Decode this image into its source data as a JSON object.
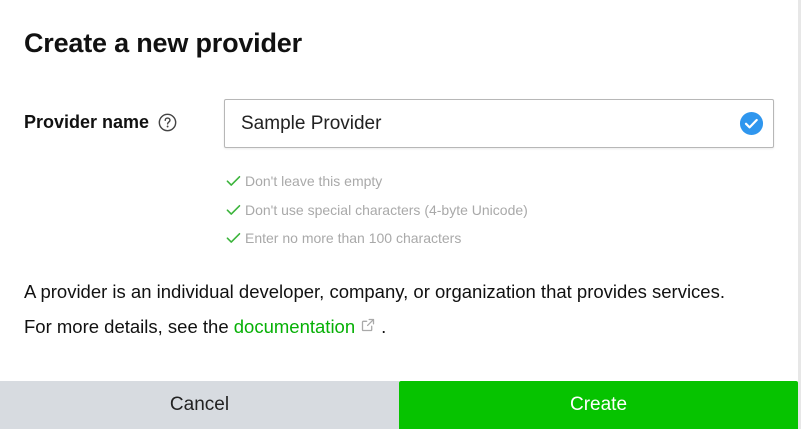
{
  "dialog": {
    "title": "Create a new provider"
  },
  "field": {
    "label": "Provider name",
    "help_icon": "question-circle-icon",
    "value": "Sample Provider",
    "valid_icon": "check-circle-icon"
  },
  "validation": {
    "check_icon": "check-icon",
    "rules": [
      "Don't leave this empty",
      "Don't use special characters (4-byte Unicode)",
      "Enter no more than 100 characters"
    ]
  },
  "description": {
    "text_before": "A provider is an individual developer, company, or organization that provides services. For more details, see the ",
    "link_text": "documentation",
    "link_icon": "external-link-icon",
    "text_after": "."
  },
  "footer": {
    "cancel_label": "Cancel",
    "create_label": "Create"
  },
  "colors": {
    "brand_green": "#06C300",
    "link_green": "#06B006",
    "valid_blue": "#2F96EE",
    "rule_green": "#3CB43C",
    "cancel_gray": "#D7DBE0"
  }
}
